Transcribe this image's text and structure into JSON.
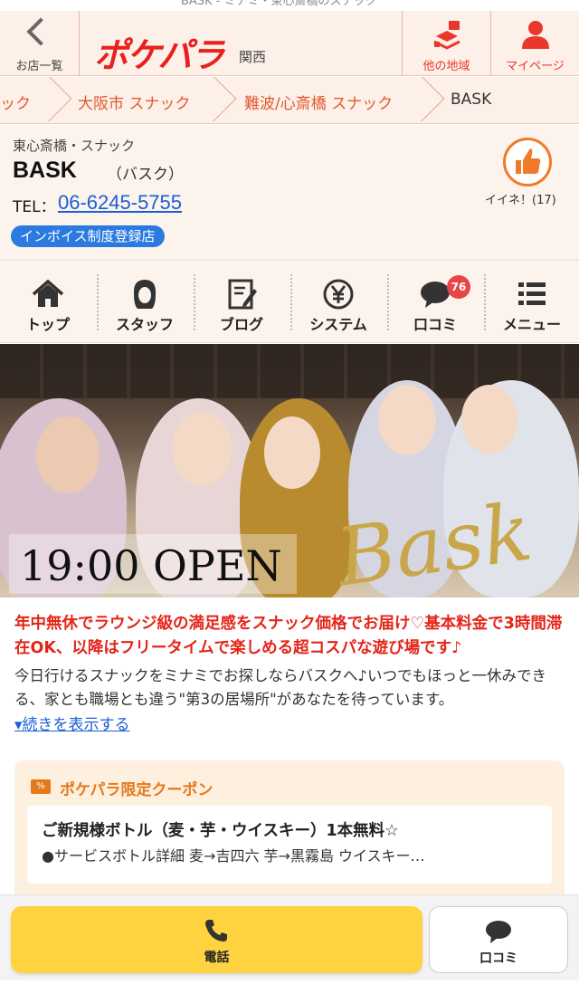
{
  "top_strip": {
    "text": "BASK - ミナミ・東心斎橋のスナック"
  },
  "header": {
    "back_label": "お店一覧",
    "logo": "ポケパラ",
    "region": "関西",
    "area_label": "他の地域",
    "mypage_label": "マイページ"
  },
  "breadcrumb": [
    "ック",
    "大阪市 スナック",
    "難波/心斎橋 スナック",
    "BASK"
  ],
  "shop": {
    "area": "東心斎橋・スナック",
    "name": "BASK",
    "kana": "（バスク）",
    "tel_label": "TEL：",
    "tel": "06-6245-5755",
    "invoice_badge": "インボイス制度登録店",
    "like_label": "イイネ！(17)"
  },
  "nav": {
    "items": [
      {
        "label": "トップ",
        "icon": "home-icon"
      },
      {
        "label": "スタッフ",
        "icon": "staff-icon"
      },
      {
        "label": "ブログ",
        "icon": "blog-icon"
      },
      {
        "label": "システム",
        "icon": "yen-icon"
      },
      {
        "label": "口コミ",
        "icon": "chat-icon",
        "badge": "76"
      },
      {
        "label": "メニュー",
        "icon": "menu-icon"
      }
    ]
  },
  "hero": {
    "open_text": "19:00 OPEN",
    "logo_text": "Bask"
  },
  "description": {
    "catch": "年中無休でラウンジ級の満足感をスナック価格でお届け♡基本料金で3時間滞在OK、以降はフリータイムで楽しめる超コスパな遊び場です♪",
    "body": "今日行けるスナックをミナミでお探しならバスクへ♪いつでもほっと一休みできる、家とも職場とも違う\"第3の居場所\"があなたを待っています。",
    "more_link": "▾続きを表示する"
  },
  "coupon": {
    "title": "ポケパラ限定クーポン",
    "icon_text": "%",
    "item_title": "ご新規様ボトル（麦・芋・ウイスキー）1本無料☆",
    "item_detail": "●サービスボトル詳細 麦→吉四六 芋→黒霧島 ウイスキー…"
  },
  "bottom": {
    "call_label": "電話",
    "review_label": "口コミ"
  },
  "colors": {
    "brand_red": "#e8201e",
    "accent_orange": "#f07a28",
    "link_blue": "#1a5fd6",
    "call_yellow": "#ffd23f"
  }
}
